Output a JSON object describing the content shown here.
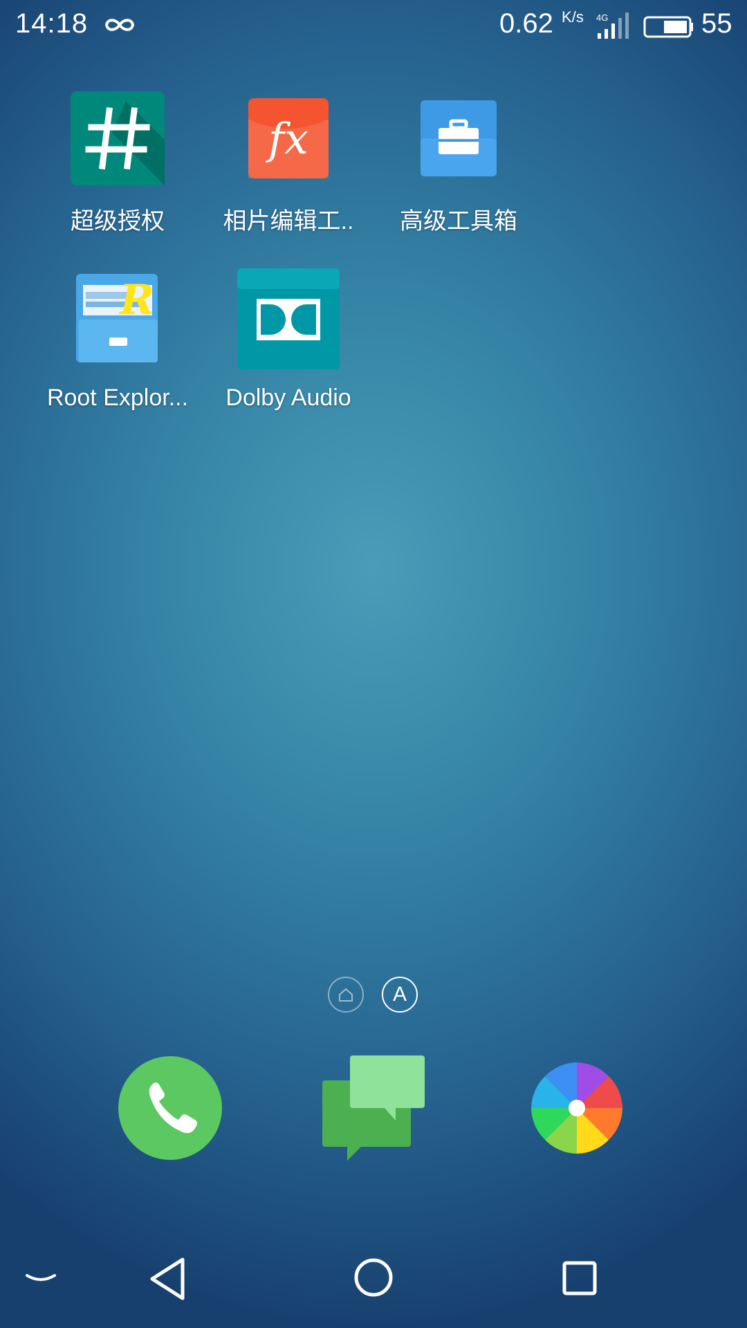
{
  "status_bar": {
    "time": "14:18",
    "network_speed": "0.62",
    "speed_unit_top": "K",
    "speed_unit_bottom": "s",
    "network_type": "4G",
    "battery_level": "55",
    "icons": [
      "infinity-icon",
      "signal-icon",
      "battery-icon"
    ]
  },
  "home_apps": [
    {
      "label": "超级授权",
      "icon": "hash-icon",
      "color": "#00897b"
    },
    {
      "label": "相片编辑工..",
      "icon": "fx-icon",
      "color": "#f4542f"
    },
    {
      "label": "高级工具箱",
      "icon": "toolbox-icon",
      "color": "#3f9ae6"
    },
    {
      "label": "Root Explor...",
      "icon": "file-cabinet-icon",
      "color": "#4aa8e8"
    },
    {
      "label": "Dolby Audio",
      "icon": "dolby-icon",
      "color": "#0097a7"
    }
  ],
  "pager": {
    "home_icon": "home-icon",
    "all_apps_label": "A"
  },
  "dock": [
    {
      "name": "phone",
      "icon": "phone-icon",
      "color": "#5bc862"
    },
    {
      "name": "messages",
      "icon": "chat-bubbles-icon",
      "color": "#5cbf5d"
    },
    {
      "name": "gallery",
      "icon": "pinwheel-icon",
      "color": "#ef4b4b"
    }
  ],
  "nav_bar": {
    "icons": [
      "chevron-down-icon",
      "back-icon",
      "home-circle-icon",
      "recents-icon"
    ]
  }
}
